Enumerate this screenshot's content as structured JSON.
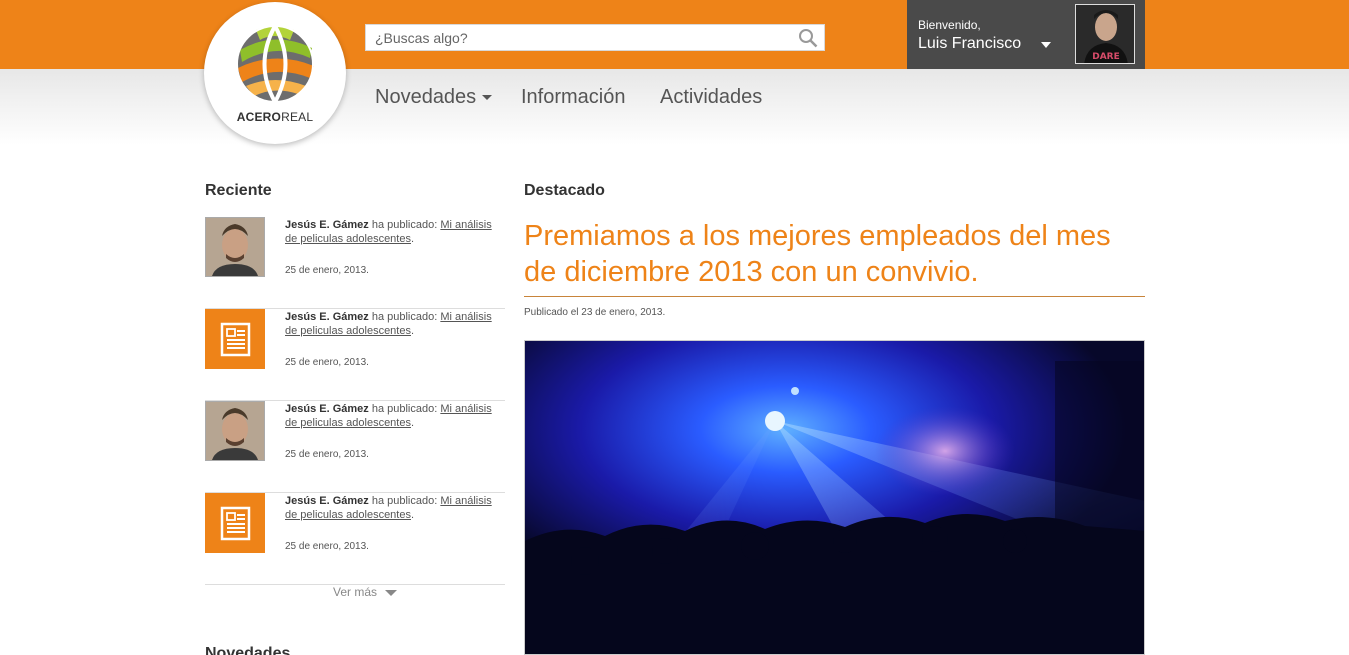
{
  "header": {
    "logo_text_bold": "ACERO",
    "logo_text_light": "REAL",
    "search_placeholder": "¿Buscas algo?",
    "welcome": "Bienvenido,",
    "username": "Luis Francisco",
    "avatar_shirt_text": "DARE"
  },
  "nav": {
    "items": [
      {
        "label": "Novedades"
      },
      {
        "label": "Información"
      },
      {
        "label": "Actividades"
      }
    ]
  },
  "recent": {
    "title": "Reciente",
    "items": [
      {
        "author": "Jesús E. Gámez",
        "action": " ha publicado: ",
        "link": "Mi análisis de peliculas adolescentes",
        "date": "25 de enero, 2013.",
        "thumb": "photo"
      },
      {
        "author": "Jesús E. Gámez",
        "action": " ha publicado: ",
        "link": "Mi análisis de peliculas adolescentes",
        "date": "25 de enero, 2013.",
        "thumb": "document-icon"
      },
      {
        "author": "Jesús E. Gámez",
        "action": " ha publicado: ",
        "link": "Mi análisis de peliculas adolescentes",
        "date": "25 de enero, 2013.",
        "thumb": "photo"
      },
      {
        "author": "Jesús E. Gámez",
        "action": " ha publicado: ",
        "link": "Mi análisis de peliculas adolescentes",
        "date": "25 de enero, 2013.",
        "thumb": "document-icon"
      }
    ],
    "more": "Ver más",
    "next_section_title": "Novedades"
  },
  "featured": {
    "title": "Destacado",
    "headline": "Premiamos a los mejores empleados del mes de diciembre 2013 con un convivio.",
    "published": "Publicado el 23 de enero, 2013."
  },
  "colors": {
    "brand_orange": "#ee8318",
    "user_box": "#4a4a4a"
  }
}
